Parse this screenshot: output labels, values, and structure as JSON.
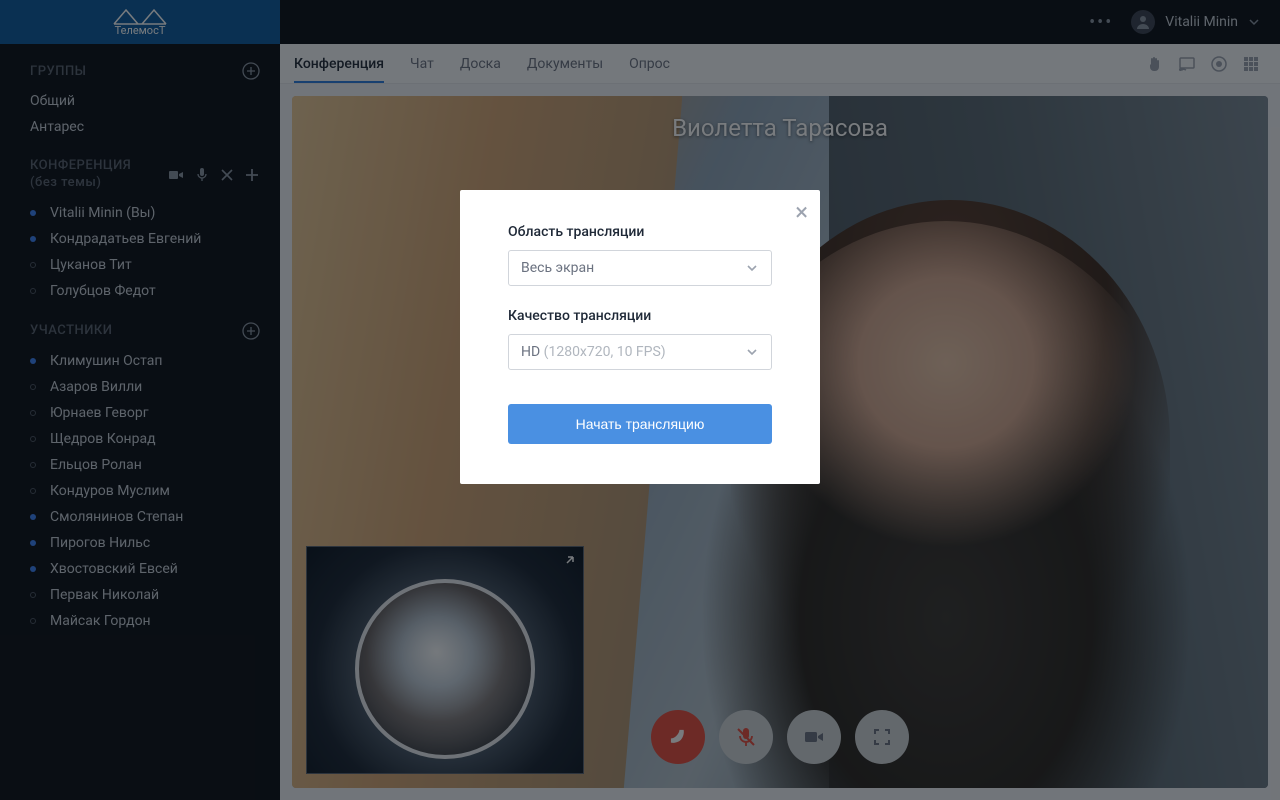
{
  "brand": {
    "name": "ТелемосТ"
  },
  "topbar": {
    "user_name": "Vitalii Minin"
  },
  "sidebar": {
    "groups_title": "ГРУППЫ",
    "groups": [
      {
        "label": "Общий"
      },
      {
        "label": "Антарес"
      }
    ],
    "conference_title": "КОНФЕРЕНЦИЯ",
    "conference_subtitle": "(без темы)",
    "conference_members": [
      {
        "label": "Vitalii Minin (Вы)",
        "online": true
      },
      {
        "label": "Кондрадатьев Евгений",
        "online": true
      },
      {
        "label": "Цуканов Тит",
        "online": false
      },
      {
        "label": "Голубцов Федот",
        "online": false
      }
    ],
    "participants_title": "УЧАСТНИКИ",
    "participants": [
      {
        "label": "Климушин Остап",
        "online": true
      },
      {
        "label": "Азаров Вилли",
        "online": false
      },
      {
        "label": "Юрнаев Геворг",
        "online": false
      },
      {
        "label": "Щедров Конрад",
        "online": false
      },
      {
        "label": "Ельцов Ролан",
        "online": false
      },
      {
        "label": "Кондуров Муслим",
        "online": false
      },
      {
        "label": "Смолянинов Степан",
        "online": true
      },
      {
        "label": "Пирогов Нильс",
        "online": true
      },
      {
        "label": "Хвостовский Евсей",
        "online": true
      },
      {
        "label": "Первак Николай",
        "online": false
      },
      {
        "label": "Майсак Гордон",
        "online": false
      }
    ]
  },
  "tabs": [
    {
      "label": "Конференция",
      "active": true
    },
    {
      "label": "Чат",
      "active": false
    },
    {
      "label": "Доска",
      "active": false
    },
    {
      "label": "Документы",
      "active": false
    },
    {
      "label": "Опрос",
      "active": false
    }
  ],
  "stage": {
    "participant_name": "Виолетта Тарасова"
  },
  "modal": {
    "area_label": "Область трансляции",
    "area_value": "Весь экран",
    "quality_label": "Качество трансляции",
    "quality_value": "HD",
    "quality_detail": "(1280x720, 10 FPS)",
    "submit": "Начать трансляцию"
  }
}
